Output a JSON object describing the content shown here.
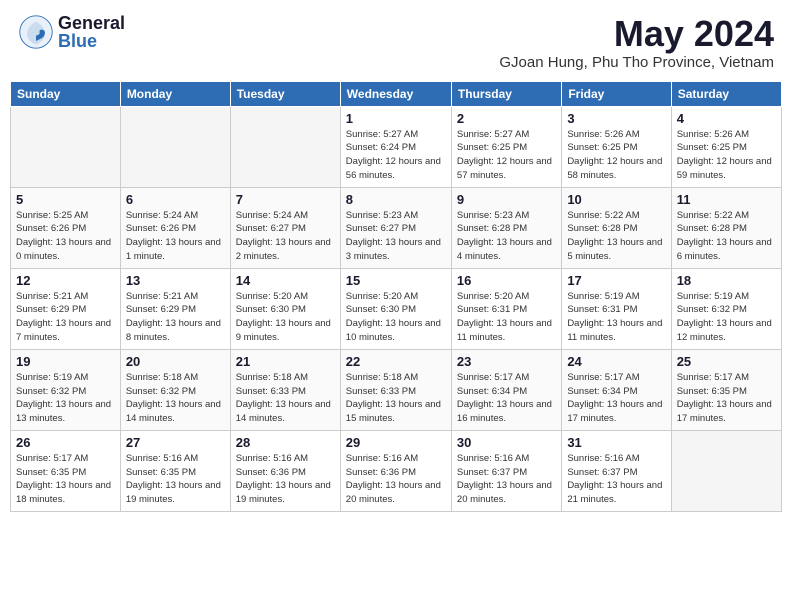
{
  "header": {
    "logo_general": "General",
    "logo_blue": "Blue",
    "month_year": "May 2024",
    "location": "GJoan Hung, Phu Tho Province, Vietnam"
  },
  "days_of_week": [
    "Sunday",
    "Monday",
    "Tuesday",
    "Wednesday",
    "Thursday",
    "Friday",
    "Saturday"
  ],
  "weeks": [
    {
      "days": [
        {
          "num": "",
          "info": ""
        },
        {
          "num": "",
          "info": ""
        },
        {
          "num": "",
          "info": ""
        },
        {
          "num": "1",
          "info": "Sunrise: 5:27 AM\nSunset: 6:24 PM\nDaylight: 12 hours\nand 56 minutes."
        },
        {
          "num": "2",
          "info": "Sunrise: 5:27 AM\nSunset: 6:25 PM\nDaylight: 12 hours\nand 57 minutes."
        },
        {
          "num": "3",
          "info": "Sunrise: 5:26 AM\nSunset: 6:25 PM\nDaylight: 12 hours\nand 58 minutes."
        },
        {
          "num": "4",
          "info": "Sunrise: 5:26 AM\nSunset: 6:25 PM\nDaylight: 12 hours\nand 59 minutes."
        }
      ]
    },
    {
      "days": [
        {
          "num": "5",
          "info": "Sunrise: 5:25 AM\nSunset: 6:26 PM\nDaylight: 13 hours\nand 0 minutes."
        },
        {
          "num": "6",
          "info": "Sunrise: 5:24 AM\nSunset: 6:26 PM\nDaylight: 13 hours\nand 1 minute."
        },
        {
          "num": "7",
          "info": "Sunrise: 5:24 AM\nSunset: 6:27 PM\nDaylight: 13 hours\nand 2 minutes."
        },
        {
          "num": "8",
          "info": "Sunrise: 5:23 AM\nSunset: 6:27 PM\nDaylight: 13 hours\nand 3 minutes."
        },
        {
          "num": "9",
          "info": "Sunrise: 5:23 AM\nSunset: 6:28 PM\nDaylight: 13 hours\nand 4 minutes."
        },
        {
          "num": "10",
          "info": "Sunrise: 5:22 AM\nSunset: 6:28 PM\nDaylight: 13 hours\nand 5 minutes."
        },
        {
          "num": "11",
          "info": "Sunrise: 5:22 AM\nSunset: 6:28 PM\nDaylight: 13 hours\nand 6 minutes."
        }
      ]
    },
    {
      "days": [
        {
          "num": "12",
          "info": "Sunrise: 5:21 AM\nSunset: 6:29 PM\nDaylight: 13 hours\nand 7 minutes."
        },
        {
          "num": "13",
          "info": "Sunrise: 5:21 AM\nSunset: 6:29 PM\nDaylight: 13 hours\nand 8 minutes."
        },
        {
          "num": "14",
          "info": "Sunrise: 5:20 AM\nSunset: 6:30 PM\nDaylight: 13 hours\nand 9 minutes."
        },
        {
          "num": "15",
          "info": "Sunrise: 5:20 AM\nSunset: 6:30 PM\nDaylight: 13 hours\nand 10 minutes."
        },
        {
          "num": "16",
          "info": "Sunrise: 5:20 AM\nSunset: 6:31 PM\nDaylight: 13 hours\nand 11 minutes."
        },
        {
          "num": "17",
          "info": "Sunrise: 5:19 AM\nSunset: 6:31 PM\nDaylight: 13 hours\nand 11 minutes."
        },
        {
          "num": "18",
          "info": "Sunrise: 5:19 AM\nSunset: 6:32 PM\nDaylight: 13 hours\nand 12 minutes."
        }
      ]
    },
    {
      "days": [
        {
          "num": "19",
          "info": "Sunrise: 5:19 AM\nSunset: 6:32 PM\nDaylight: 13 hours\nand 13 minutes."
        },
        {
          "num": "20",
          "info": "Sunrise: 5:18 AM\nSunset: 6:32 PM\nDaylight: 13 hours\nand 14 minutes."
        },
        {
          "num": "21",
          "info": "Sunrise: 5:18 AM\nSunset: 6:33 PM\nDaylight: 13 hours\nand 14 minutes."
        },
        {
          "num": "22",
          "info": "Sunrise: 5:18 AM\nSunset: 6:33 PM\nDaylight: 13 hours\nand 15 minutes."
        },
        {
          "num": "23",
          "info": "Sunrise: 5:17 AM\nSunset: 6:34 PM\nDaylight: 13 hours\nand 16 minutes."
        },
        {
          "num": "24",
          "info": "Sunrise: 5:17 AM\nSunset: 6:34 PM\nDaylight: 13 hours\nand 17 minutes."
        },
        {
          "num": "25",
          "info": "Sunrise: 5:17 AM\nSunset: 6:35 PM\nDaylight: 13 hours\nand 17 minutes."
        }
      ]
    },
    {
      "days": [
        {
          "num": "26",
          "info": "Sunrise: 5:17 AM\nSunset: 6:35 PM\nDaylight: 13 hours\nand 18 minutes."
        },
        {
          "num": "27",
          "info": "Sunrise: 5:16 AM\nSunset: 6:35 PM\nDaylight: 13 hours\nand 19 minutes."
        },
        {
          "num": "28",
          "info": "Sunrise: 5:16 AM\nSunset: 6:36 PM\nDaylight: 13 hours\nand 19 minutes."
        },
        {
          "num": "29",
          "info": "Sunrise: 5:16 AM\nSunset: 6:36 PM\nDaylight: 13 hours\nand 20 minutes."
        },
        {
          "num": "30",
          "info": "Sunrise: 5:16 AM\nSunset: 6:37 PM\nDaylight: 13 hours\nand 20 minutes."
        },
        {
          "num": "31",
          "info": "Sunrise: 5:16 AM\nSunset: 6:37 PM\nDaylight: 13 hours\nand 21 minutes."
        },
        {
          "num": "",
          "info": ""
        }
      ]
    }
  ]
}
